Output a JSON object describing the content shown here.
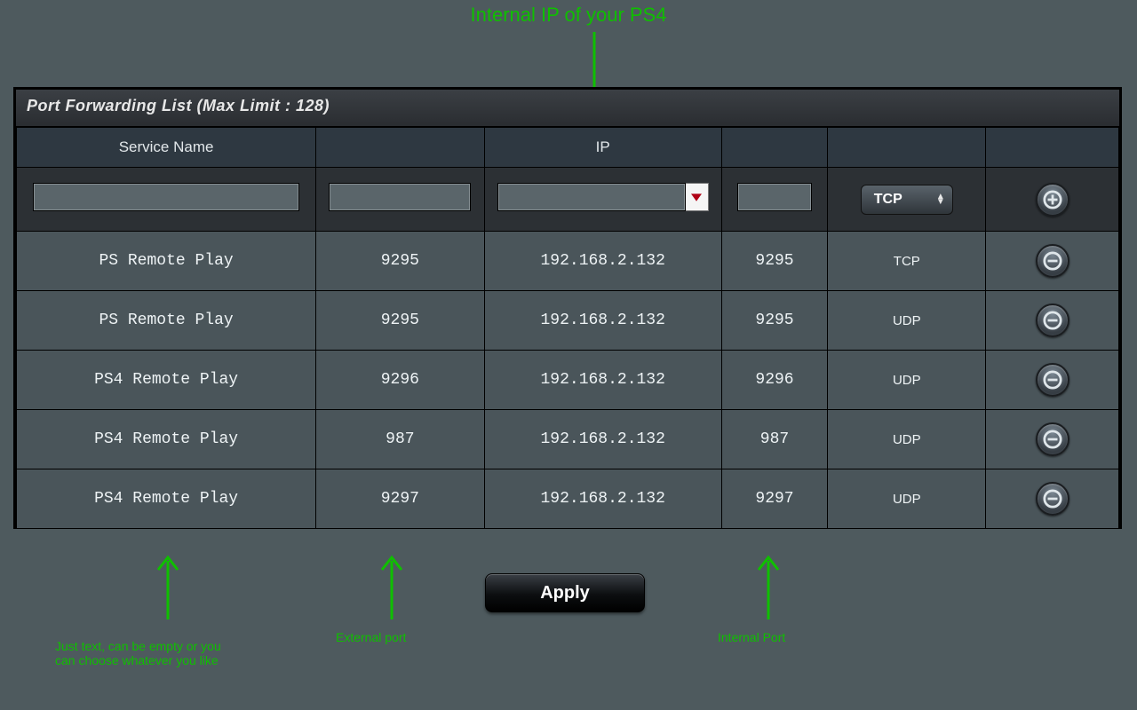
{
  "annotations": {
    "top": "Internal IP of your PS4",
    "service_name": "Just text, can be empty or you can choose whatever you like",
    "external_port": "External port",
    "internal_port": "Internal Port"
  },
  "panel": {
    "title": "Port Forwarding List (Max Limit : 128)"
  },
  "columns": {
    "service_name": "Service Name",
    "ext_port": "",
    "ip": "IP",
    "int_port": "",
    "protocol": "",
    "action": ""
  },
  "input_row": {
    "service_name": "",
    "ext_port": "",
    "ip": "",
    "int_port": "",
    "protocol": "TCP"
  },
  "rows": [
    {
      "service_name": "PS Remote Play",
      "ext_port": "9295",
      "ip": "192.168.2.132",
      "int_port": "9295",
      "protocol": "TCP"
    },
    {
      "service_name": "PS Remote Play",
      "ext_port": "9295",
      "ip": "192.168.2.132",
      "int_port": "9295",
      "protocol": "UDP"
    },
    {
      "service_name": "PS4 Remote Play",
      "ext_port": "9296",
      "ip": "192.168.2.132",
      "int_port": "9296",
      "protocol": "UDP"
    },
    {
      "service_name": "PS4 Remote Play",
      "ext_port": "987",
      "ip": "192.168.2.132",
      "int_port": "987",
      "protocol": "UDP"
    },
    {
      "service_name": "PS4 Remote Play",
      "ext_port": "9297",
      "ip": "192.168.2.132",
      "int_port": "9297",
      "protocol": "UDP"
    }
  ],
  "buttons": {
    "apply": "Apply"
  },
  "colors": {
    "annotation": "#0fbf00"
  }
}
